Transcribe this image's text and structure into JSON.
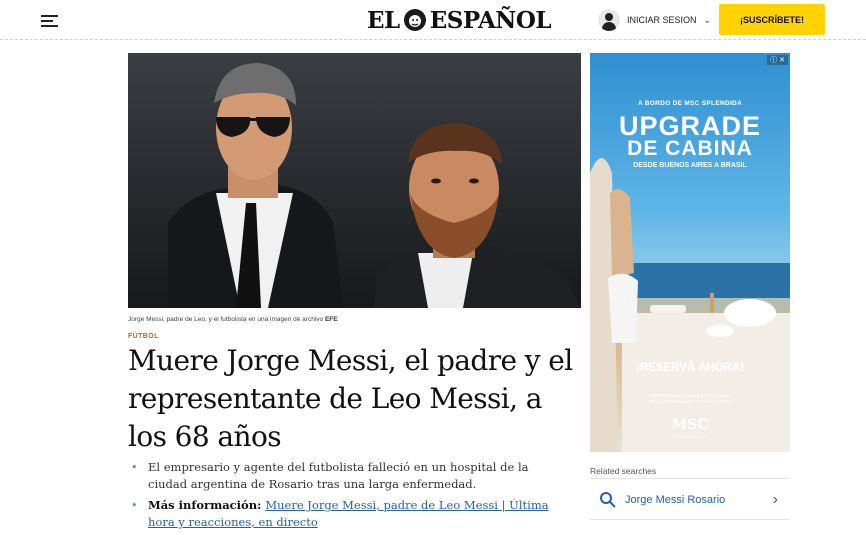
{
  "header": {
    "logo_text": "EL ESPAÑOL",
    "login_label": "INICIAR SESION",
    "subscribe_label": "¡SUSCRÍBETE!",
    "accent_color": "#ffd200"
  },
  "article": {
    "image_caption": "Jorge Messi, padre de Leo, y el futbolista en una imagen de archivo",
    "image_credit": "EFE",
    "section": "FÚTBOL",
    "headline": "Muere Jorge Messi, el padre y el representante de Leo Messi, a los 68 años",
    "summary": "El empresario y agente del futbolista falleció en un hospital de la ciudad argentina de Rosario tras una larga enfermedad.",
    "more_info_label": "Más información:",
    "more_info_link": "Muere Jorge Messi, padre de Leo Messi | Última hora y reacciones, en directo"
  },
  "ad": {
    "kicker": "A BORDO DE MSC SPLENDIDA",
    "title_line1": "UPGRADE",
    "title_line2": "DE CABINA",
    "subtitle": "DESDE BUENOS AIRES A BRASIL",
    "cta": "¡RESERVÁ AHORA!",
    "fine_print_1": "OFERTA VÁLIDA HASTA EL 31/08/2024.",
    "fine_print_2": "APLICAN TÉRMINOS Y CONDICIONES",
    "brand": "MSC",
    "brand_sub": "CRUCEROS",
    "badge": "ⓘ ✕"
  },
  "related": {
    "heading": "Related searches",
    "items": [
      {
        "label": "Jorge Messi Rosario"
      }
    ]
  },
  "icons": [
    "hamburger-icon",
    "lion-logo-icon",
    "user-icon",
    "chevron-down-icon",
    "search-icon",
    "chevron-right-icon"
  ]
}
